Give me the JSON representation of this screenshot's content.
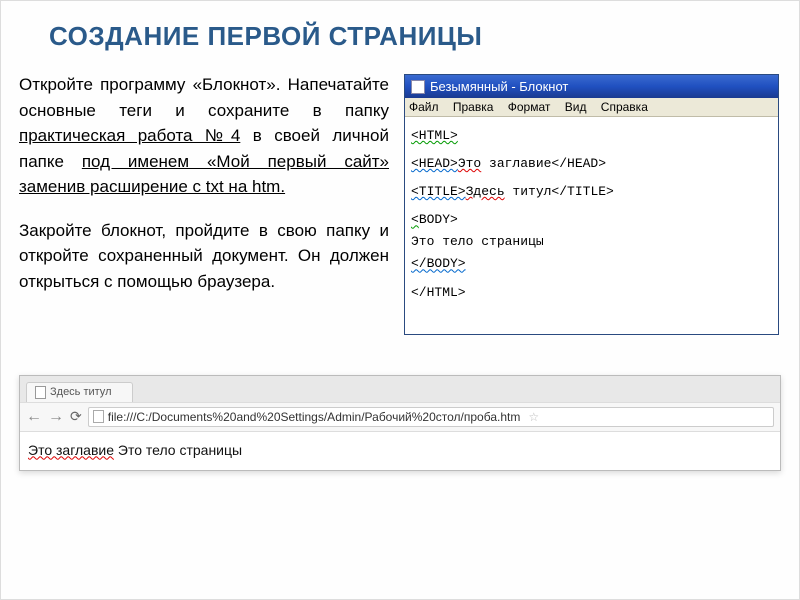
{
  "slide": {
    "title": "СОЗДАНИЕ ПЕРВОЙ СТРАНИЦЫ",
    "para1_a": "Откройте программу «Блокнот». Напечатайте основные теги и сохраните в папку ",
    "para1_link": "практическая работа №4",
    "para1_b": " в своей личной папке ",
    "para1_c": "под именем «Мой первый сайт» заменив расширение с txt на  htm.",
    "para2": "Закройте блокнот, пройдите в свою папку и откройте сохраненный документ. Он должен открыться с помощью браузера."
  },
  "notepad": {
    "title": "Безымянный - Блокнот",
    "menu": {
      "file": "Файл",
      "edit": "Правка",
      "format": "Формат",
      "view": "Вид",
      "help": "Справка"
    },
    "lines": {
      "l1": "<HTML>",
      "l2a": "<HEAD>",
      "l2b": "Это",
      "l2c": " заглавие</HEAD>",
      "l3a": "<TITLE>",
      "l3b": "Здесь",
      "l3c": " титул</TITLE>",
      "l4a": "<",
      "l4b": "BODY>",
      "l5": "Это тело страницы",
      "l6": "</BODY>",
      "l7": "</HTML>"
    }
  },
  "browser": {
    "tab_title": "Здесь титул",
    "url": "file:///C:/Documents%20and%20Settings/Admin/Рабочий%20стол/проба.htm",
    "content_a": "Это заглавие",
    "content_b": " Это тело страницы"
  }
}
